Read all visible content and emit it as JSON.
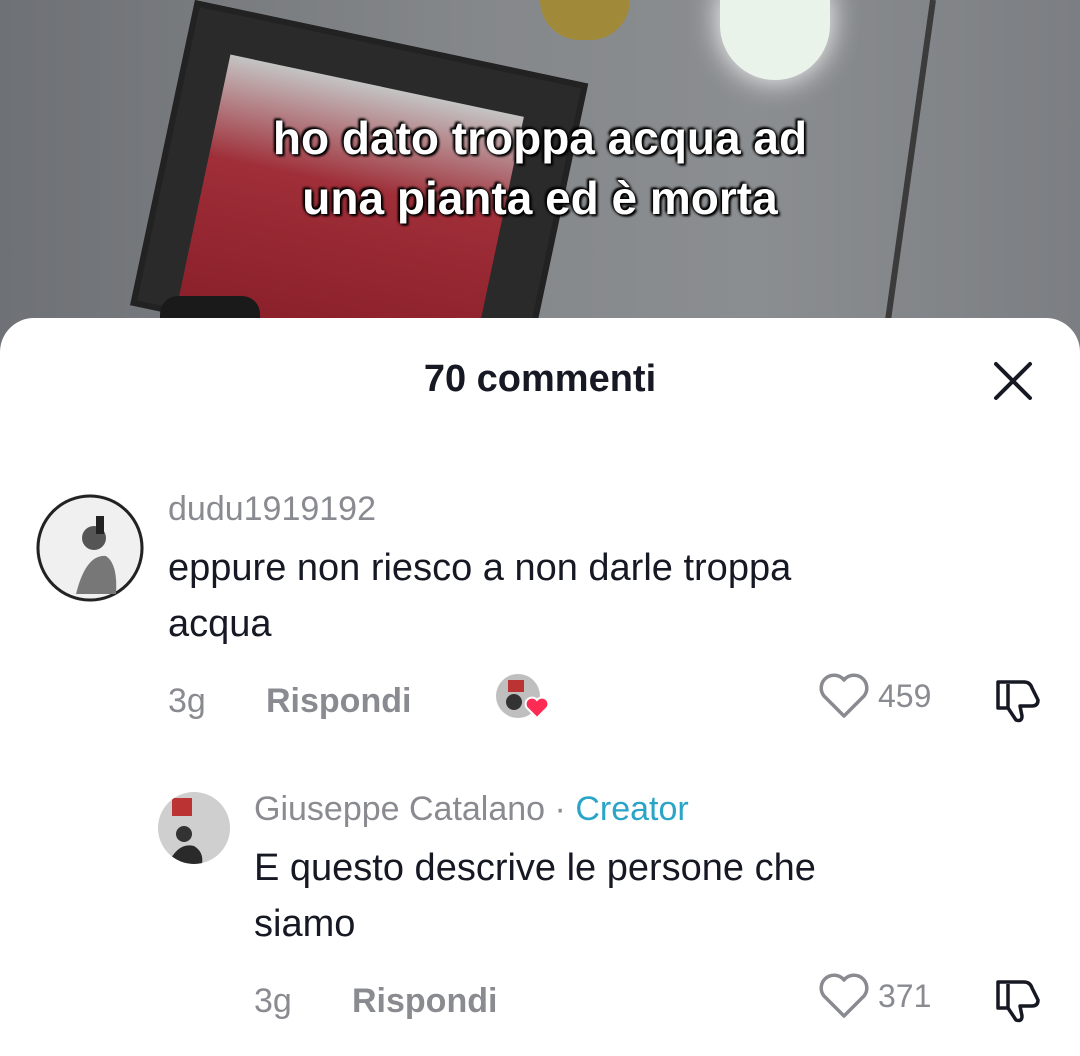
{
  "video": {
    "caption_lines": [
      "ho dato troppa acqua ad",
      "una pianta ed è morta"
    ]
  },
  "comments_sheet": {
    "title": "70 commenti",
    "close_icon": "close-icon"
  },
  "comments": [
    {
      "username": "dudu1919192",
      "text_lines": [
        "eppure non riesco a non darle troppa",
        "acqua"
      ],
      "time": "3g",
      "reply_label": "Rispondi",
      "likes": "459",
      "liked_by_creator": true
    },
    {
      "username": "Giuseppe Catalano",
      "separator": "·",
      "badge": "Creator",
      "text_lines": [
        "E questo descrive le persone che",
        "siamo"
      ],
      "time": "3g",
      "reply_label": "Rispondi",
      "likes": "371"
    }
  ],
  "colors": {
    "accent_creator": "#2aa5c7",
    "heart_red": "#fe2c55",
    "muted": "#8a8b91",
    "text": "#161823"
  }
}
